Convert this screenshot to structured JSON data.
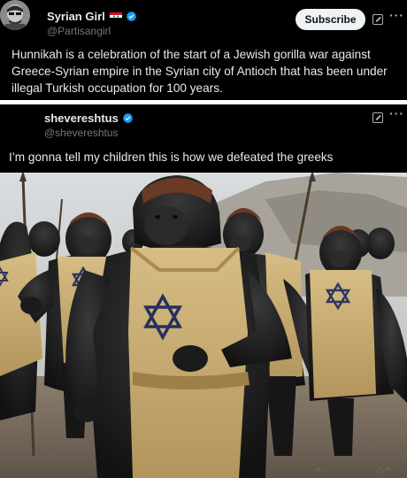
{
  "post1": {
    "author_name": "Syrian Girl",
    "handle": "@Partisangirl",
    "subscribe_label": "Subscribe",
    "text": "Hunnikah is a celebration of the start of a Jewish gorilla war against Greece-Syrian empire in the Syrian city of Antioch that has been under illegal Turkish occupation for 100 years."
  },
  "post2": {
    "author_name": "shevereshtus",
    "handle": "@shevereshtus",
    "text": "I’m gonna tell my children this is how we defeated the greeks"
  },
  "icons": {
    "verified": "verified-badge-icon",
    "flag": "syria-flag-icon",
    "grok": "grok-icon",
    "more": "more-icon"
  },
  "colors": {
    "background": "#000000",
    "text": "#e7e9ea",
    "secondary_text": "#71767b",
    "verified": "#1d9bf0",
    "subscribe_bg": "#eff3f4",
    "tunic": "#c9a96a"
  }
}
